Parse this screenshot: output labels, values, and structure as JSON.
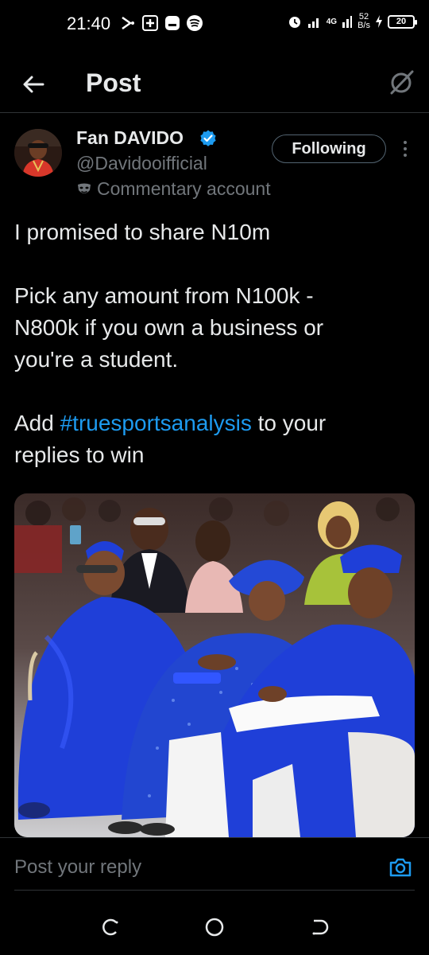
{
  "status_bar": {
    "time": "21:40",
    "network": "4G",
    "speed_value": "52",
    "speed_unit": "B/s",
    "battery": "20"
  },
  "header": {
    "title": "Post"
  },
  "post": {
    "author_name": "Fan DAVIDO",
    "author_handle": "@Davidooifficial",
    "commentary_label": "Commentary account",
    "follow_label": "Following",
    "text": {
      "line1": "I promised to share N10m",
      "para2": "Pick any amount from N100k - N800k if you own a business or you're a student.",
      "add_prefix": "Add ",
      "hashtag": "#truesportsanalysis",
      "add_suffix": " to your replies to win"
    }
  },
  "reply": {
    "placeholder": "Post your reply"
  },
  "colors": {
    "background": "#000000",
    "accent": "#1d9bf0",
    "muted": "#71767b",
    "text": "#e7e9ea",
    "agbada_blue": "#1f3fd8"
  },
  "icons": [
    "back-arrow-icon",
    "grok-icon",
    "verified-badge-icon",
    "mask-icon",
    "more-icon",
    "camera-icon",
    "recent-apps-icon",
    "home-icon",
    "back-nav-icon"
  ]
}
